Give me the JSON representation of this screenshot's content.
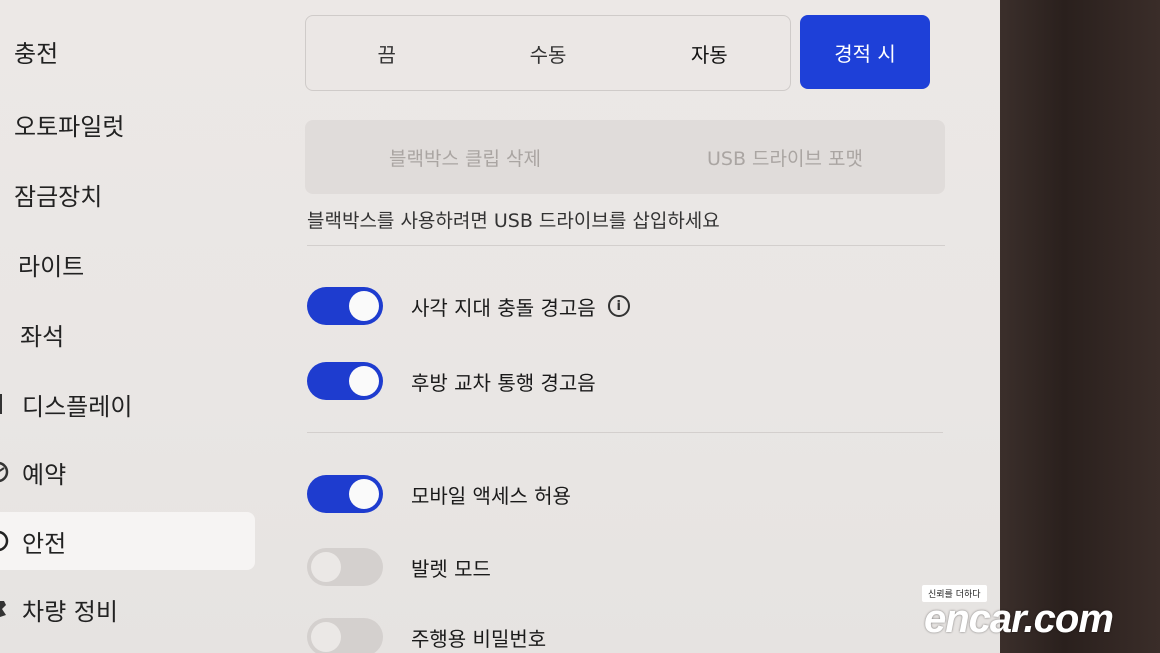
{
  "sidebar": {
    "items": [
      {
        "label": "충전",
        "icon": ""
      },
      {
        "label": "오토파일럿",
        "icon": ""
      },
      {
        "label": "잠금장치",
        "icon": ""
      },
      {
        "label": "라이트",
        "icon": ""
      },
      {
        "label": "좌석",
        "icon": ""
      },
      {
        "label": "디스플레이",
        "icon": "display-icon"
      },
      {
        "label": "예약",
        "icon": "clock-icon"
      },
      {
        "label": "안전",
        "icon": "safety-icon"
      },
      {
        "label": "차량 정비",
        "icon": "wrench-icon"
      }
    ],
    "active_index": 7
  },
  "dashcam": {
    "modes": [
      "끔",
      "수동",
      "자동"
    ],
    "selected_mode": "자동",
    "on_honk_label": "경적 시",
    "delete_clips_label": "블랙박스 클립 삭제",
    "format_usb_label": "USB 드라이브 포맷",
    "hint": "블랙박스를 사용하려면 USB 드라이브를 삽입하세요"
  },
  "toggles": [
    {
      "label": "사각 지대 충돌 경고음",
      "on": true,
      "info": true
    },
    {
      "label": "후방 교차 통행 경고음",
      "on": true,
      "info": false
    },
    {
      "label": "모바일 액세스 허용",
      "on": true,
      "info": false
    },
    {
      "label": "발렛 모드",
      "on": false,
      "info": false
    },
    {
      "label": "주행용 비밀번호",
      "on": false,
      "info": false
    }
  ],
  "watermark": {
    "tagline": "신뢰를 더하다",
    "brand": "encar.com"
  },
  "colors": {
    "accent": "#1e40d8",
    "toggle_on": "#1e3ccf",
    "toggle_off": "#d4d0ce"
  }
}
